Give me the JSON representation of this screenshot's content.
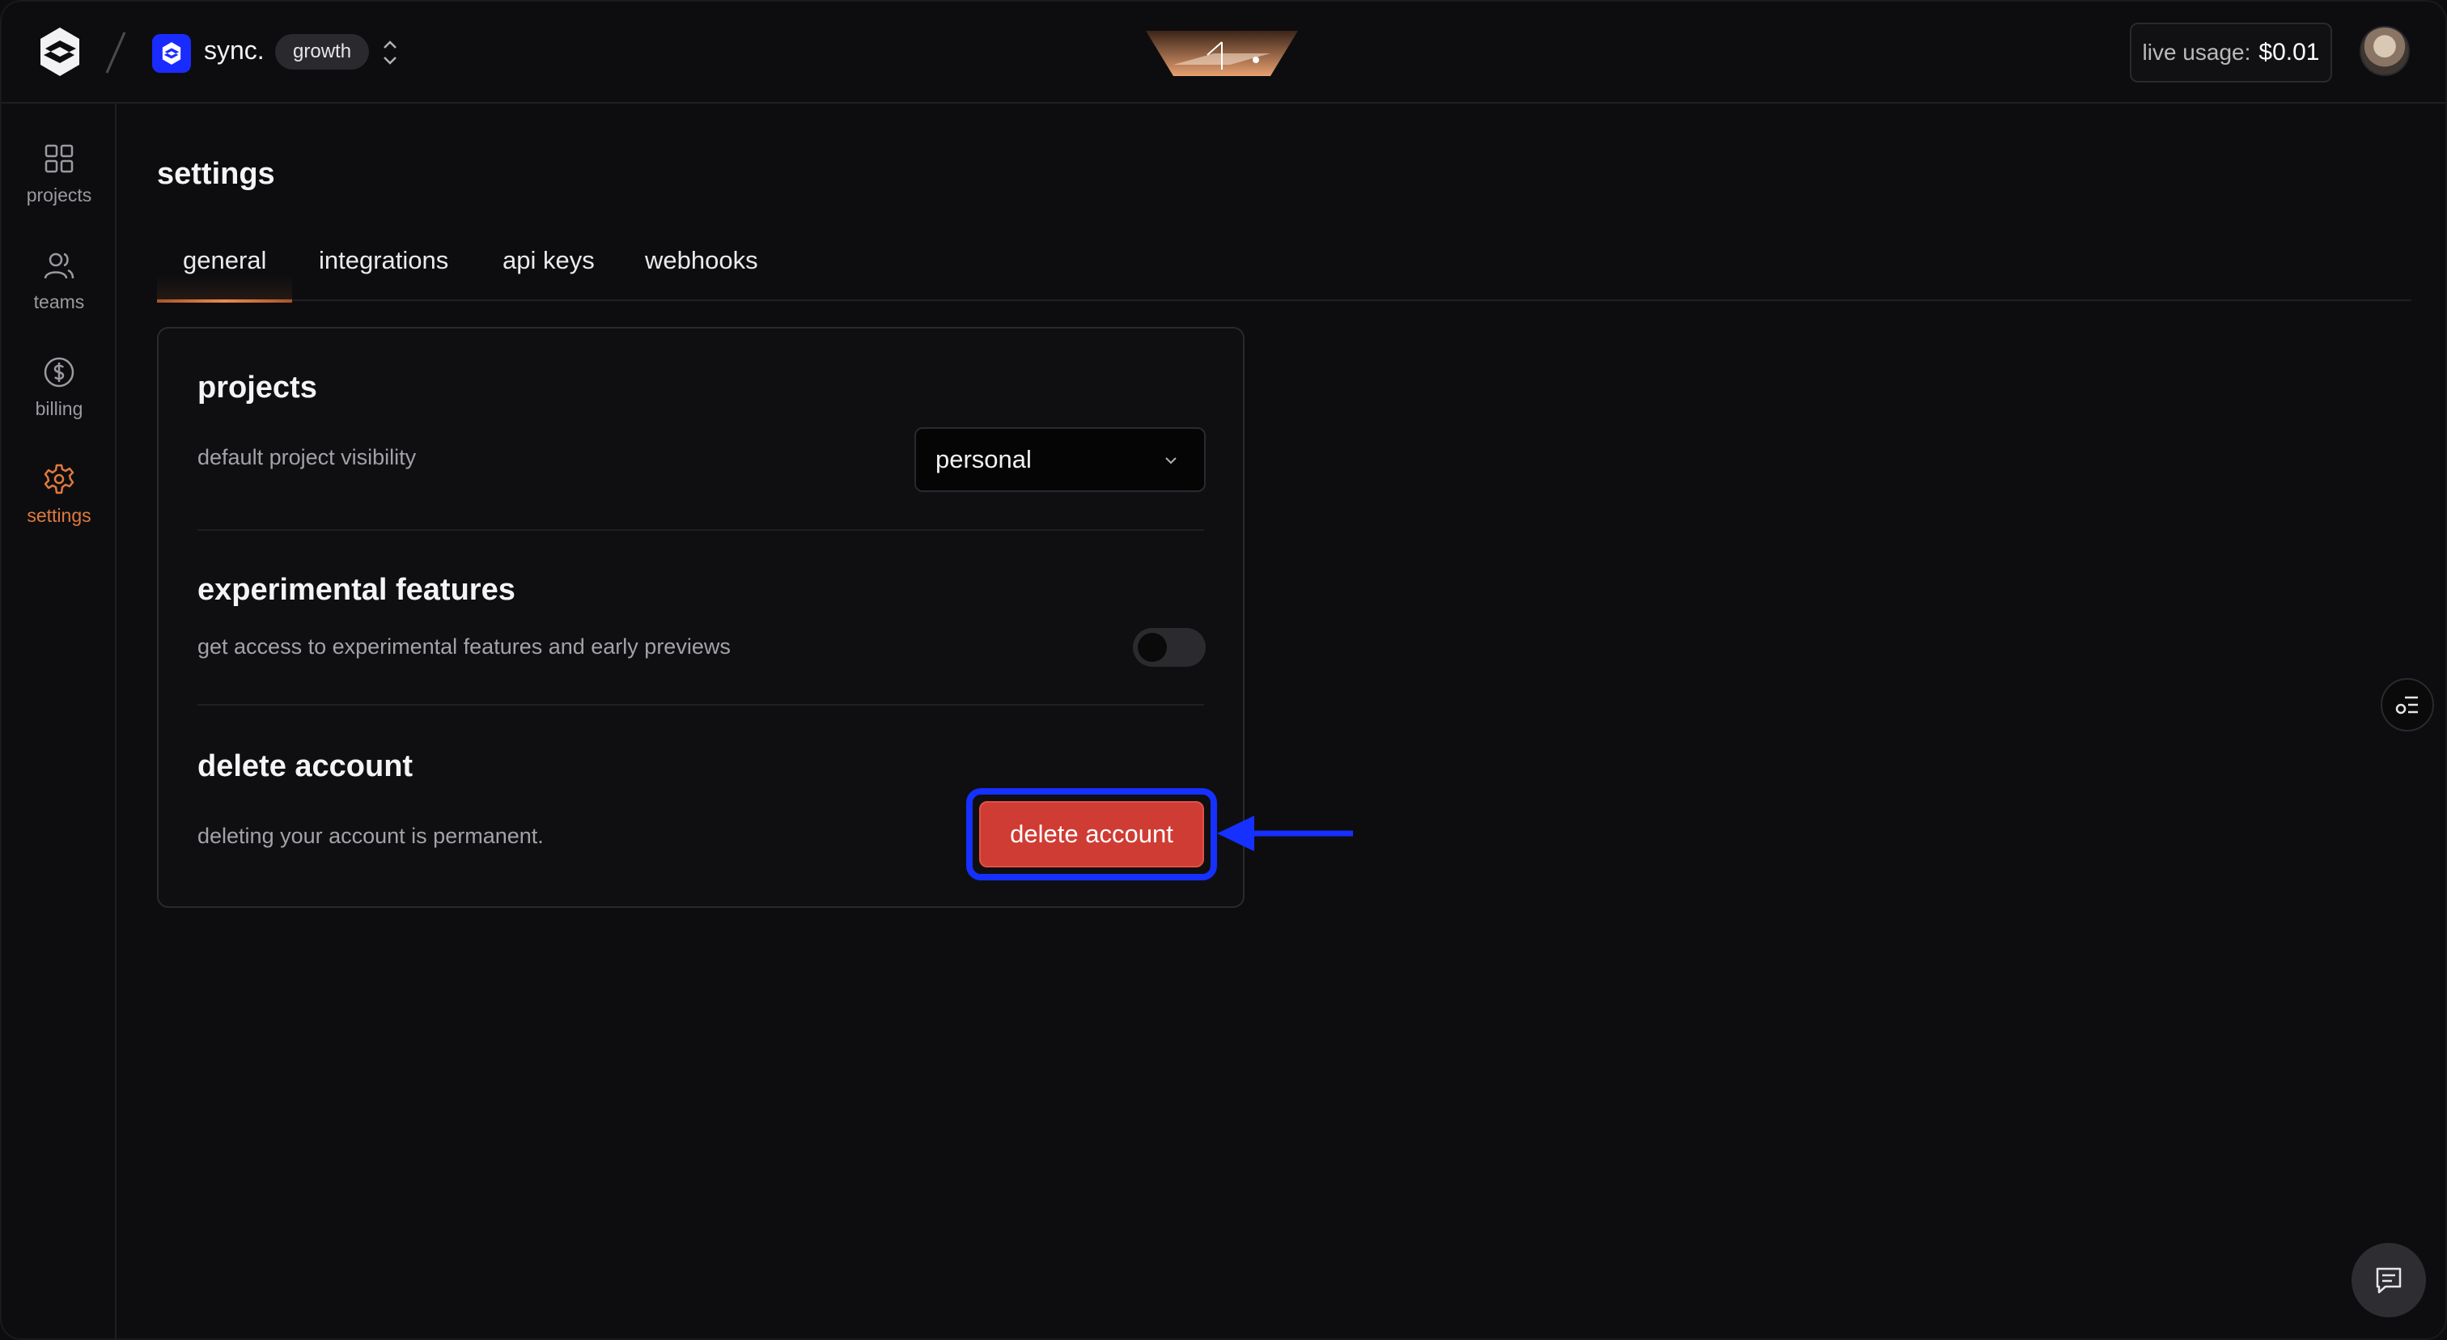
{
  "header": {
    "org_name": "sync.",
    "plan_badge": "growth",
    "usage_label": "live usage:",
    "usage_value": "$0.01"
  },
  "sidebar": {
    "items": [
      {
        "label": "projects",
        "icon": "grid-icon",
        "active": false
      },
      {
        "label": "teams",
        "icon": "users-icon",
        "active": false
      },
      {
        "label": "billing",
        "icon": "dollar-circle-icon",
        "active": false
      },
      {
        "label": "settings",
        "icon": "gear-icon",
        "active": true
      }
    ]
  },
  "main": {
    "title": "settings",
    "tabs": [
      {
        "label": "general",
        "active": true
      },
      {
        "label": "integrations",
        "active": false
      },
      {
        "label": "api keys",
        "active": false
      },
      {
        "label": "webhooks",
        "active": false
      }
    ],
    "sections": {
      "projects": {
        "title": "projects",
        "description": "default project visibility",
        "select_value": "personal"
      },
      "experimental": {
        "title": "experimental features",
        "description": "get access to experimental features and early previews",
        "toggle_on": false
      },
      "delete_account": {
        "title": "delete account",
        "description": "deleting your account is permanent.",
        "button_label": "delete account"
      }
    }
  },
  "colors": {
    "accent": "#e0793e",
    "danger": "#cf3c34",
    "highlight": "#1530ff",
    "brand": "#1a2bff"
  }
}
